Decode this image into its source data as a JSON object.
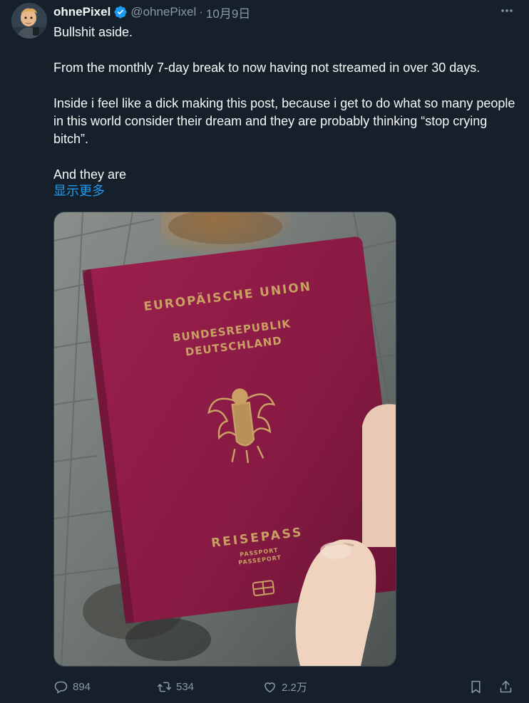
{
  "author": {
    "display_name": "ohnePixel",
    "handle": "@ohnePixel",
    "separator": "·",
    "date": "10月9日",
    "verified": true
  },
  "post": {
    "paragraphs": [
      "Bullshit aside.",
      "From the monthly 7-day break to now having not streamed in over 30 days.",
      "Inside i feel like a dick making this post, because i get to do what so many people in this world consider their dream and they are probably thinking “stop crying bitch”.",
      "And they are"
    ],
    "show_more": "显示更多"
  },
  "media": {
    "passport_lines": [
      "EUROPÄISCHE UNION",
      "BUNDESREPUBLIK",
      "DEUTSCHLAND",
      "REISEPASS",
      "PASSPORT",
      "PASSEPORT"
    ]
  },
  "actions": {
    "replies": "894",
    "retweets": "534",
    "likes": "2.2万"
  },
  "colors": {
    "background": "#15202b",
    "accent": "#1d9bf0",
    "muted": "#8b98a5",
    "passport": "#8e1a43"
  }
}
